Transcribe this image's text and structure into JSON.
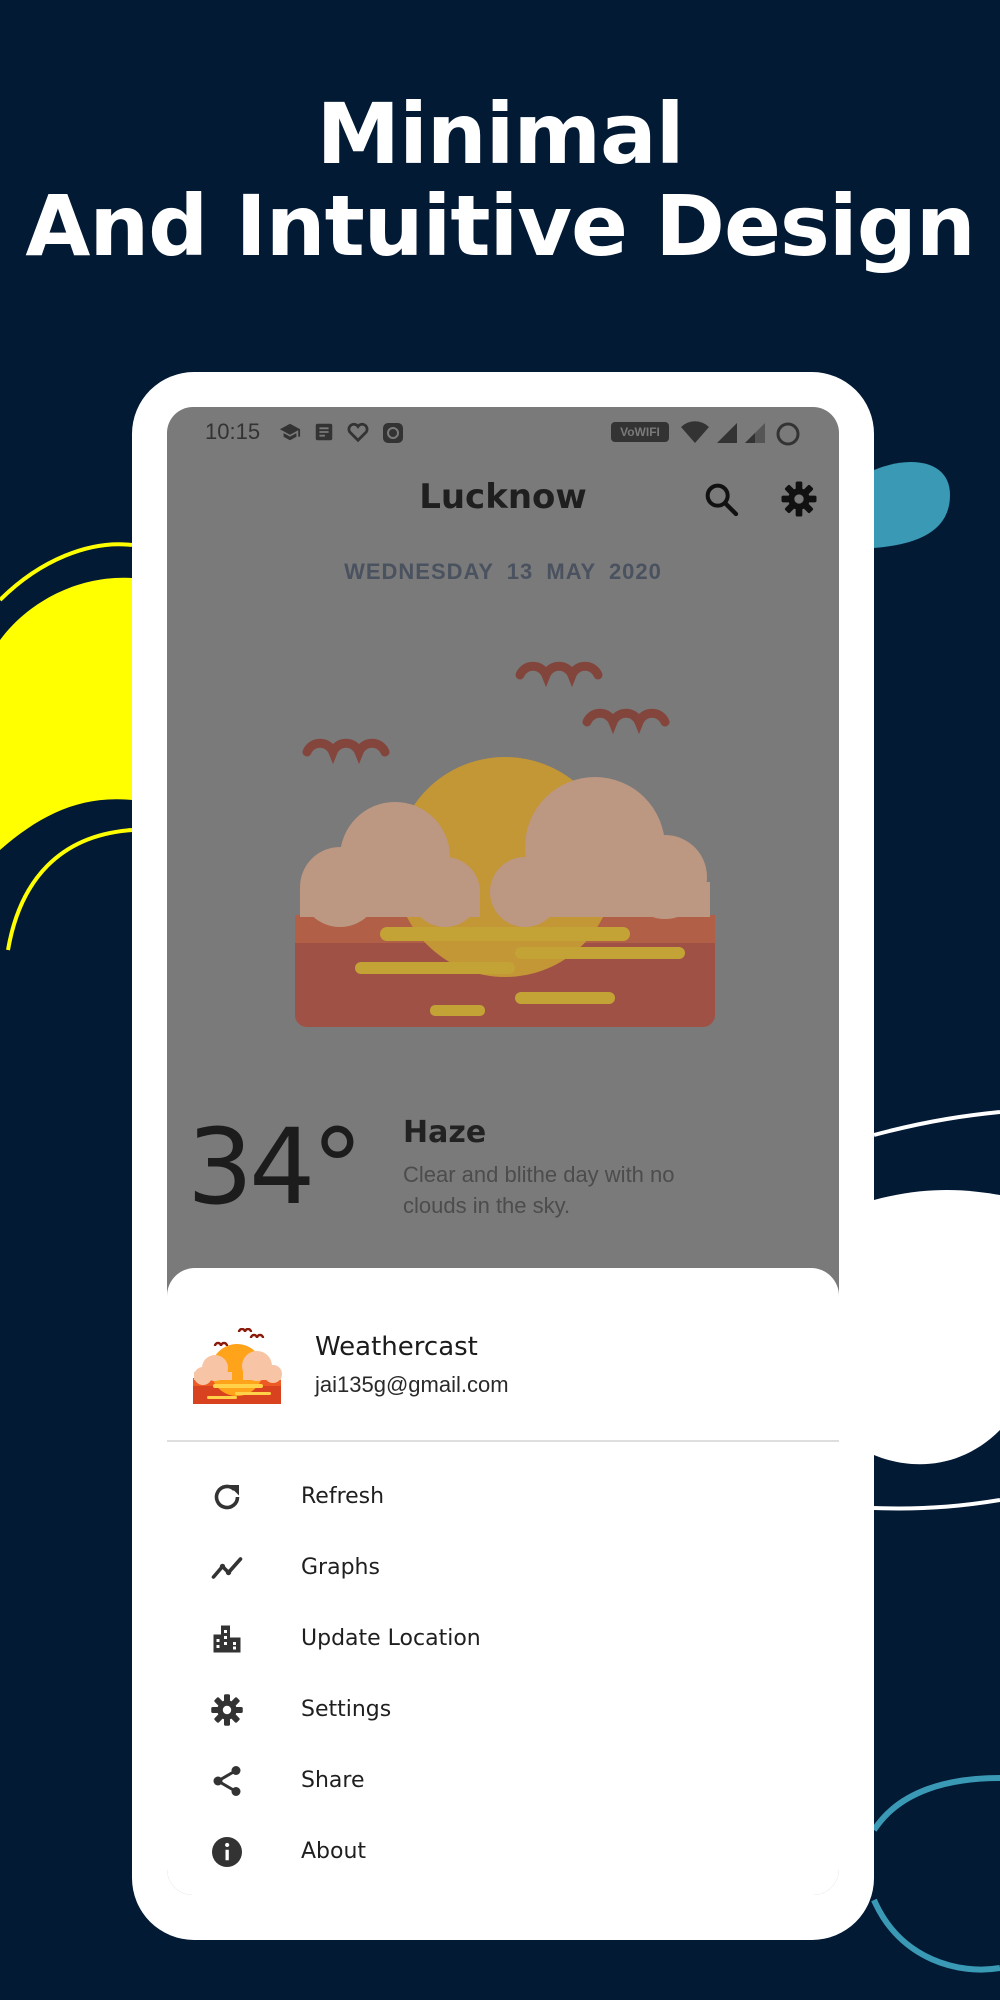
{
  "headline": {
    "line1": "Minimal",
    "line2": "And Intuitive Design"
  },
  "status_bar": {
    "time": "10:15",
    "left_icons": [
      "graduation-cap-icon",
      "document-icon",
      "heart-icon",
      "app-badge-icon"
    ],
    "vowifi_label": "VoWIFI",
    "right_icons": [
      "wifi-icon",
      "signal-icon",
      "signal-weak-icon",
      "battery-ring-icon"
    ]
  },
  "header": {
    "city": "Lucknow",
    "search_icon": "search-icon",
    "settings_icon": "gear-icon"
  },
  "date": "WEDNESDAY  13  MAY  2020",
  "weather": {
    "temperature": "34°",
    "condition": "Haze",
    "description": "Clear and blithe day with no clouds in the sky.",
    "illustration_icon": "haze-sunset-icon"
  },
  "drawer": {
    "app_name": "Weathercast",
    "account": "jai135g@gmail.com",
    "items": [
      {
        "label": "Refresh",
        "icon": "refresh-icon"
      },
      {
        "label": "Graphs",
        "icon": "graph-icon"
      },
      {
        "label": "Update Location",
        "icon": "city-icon"
      },
      {
        "label": "Settings",
        "icon": "gear-icon"
      },
      {
        "label": "Share",
        "icon": "share-icon"
      },
      {
        "label": "About",
        "icon": "info-icon"
      }
    ]
  },
  "colors": {
    "background": "#031a35",
    "yellow_accent": "#ffff00",
    "teal_accent": "#3a9ab6",
    "scrim": "#7a7a7a",
    "drawer": "#ffffff"
  }
}
